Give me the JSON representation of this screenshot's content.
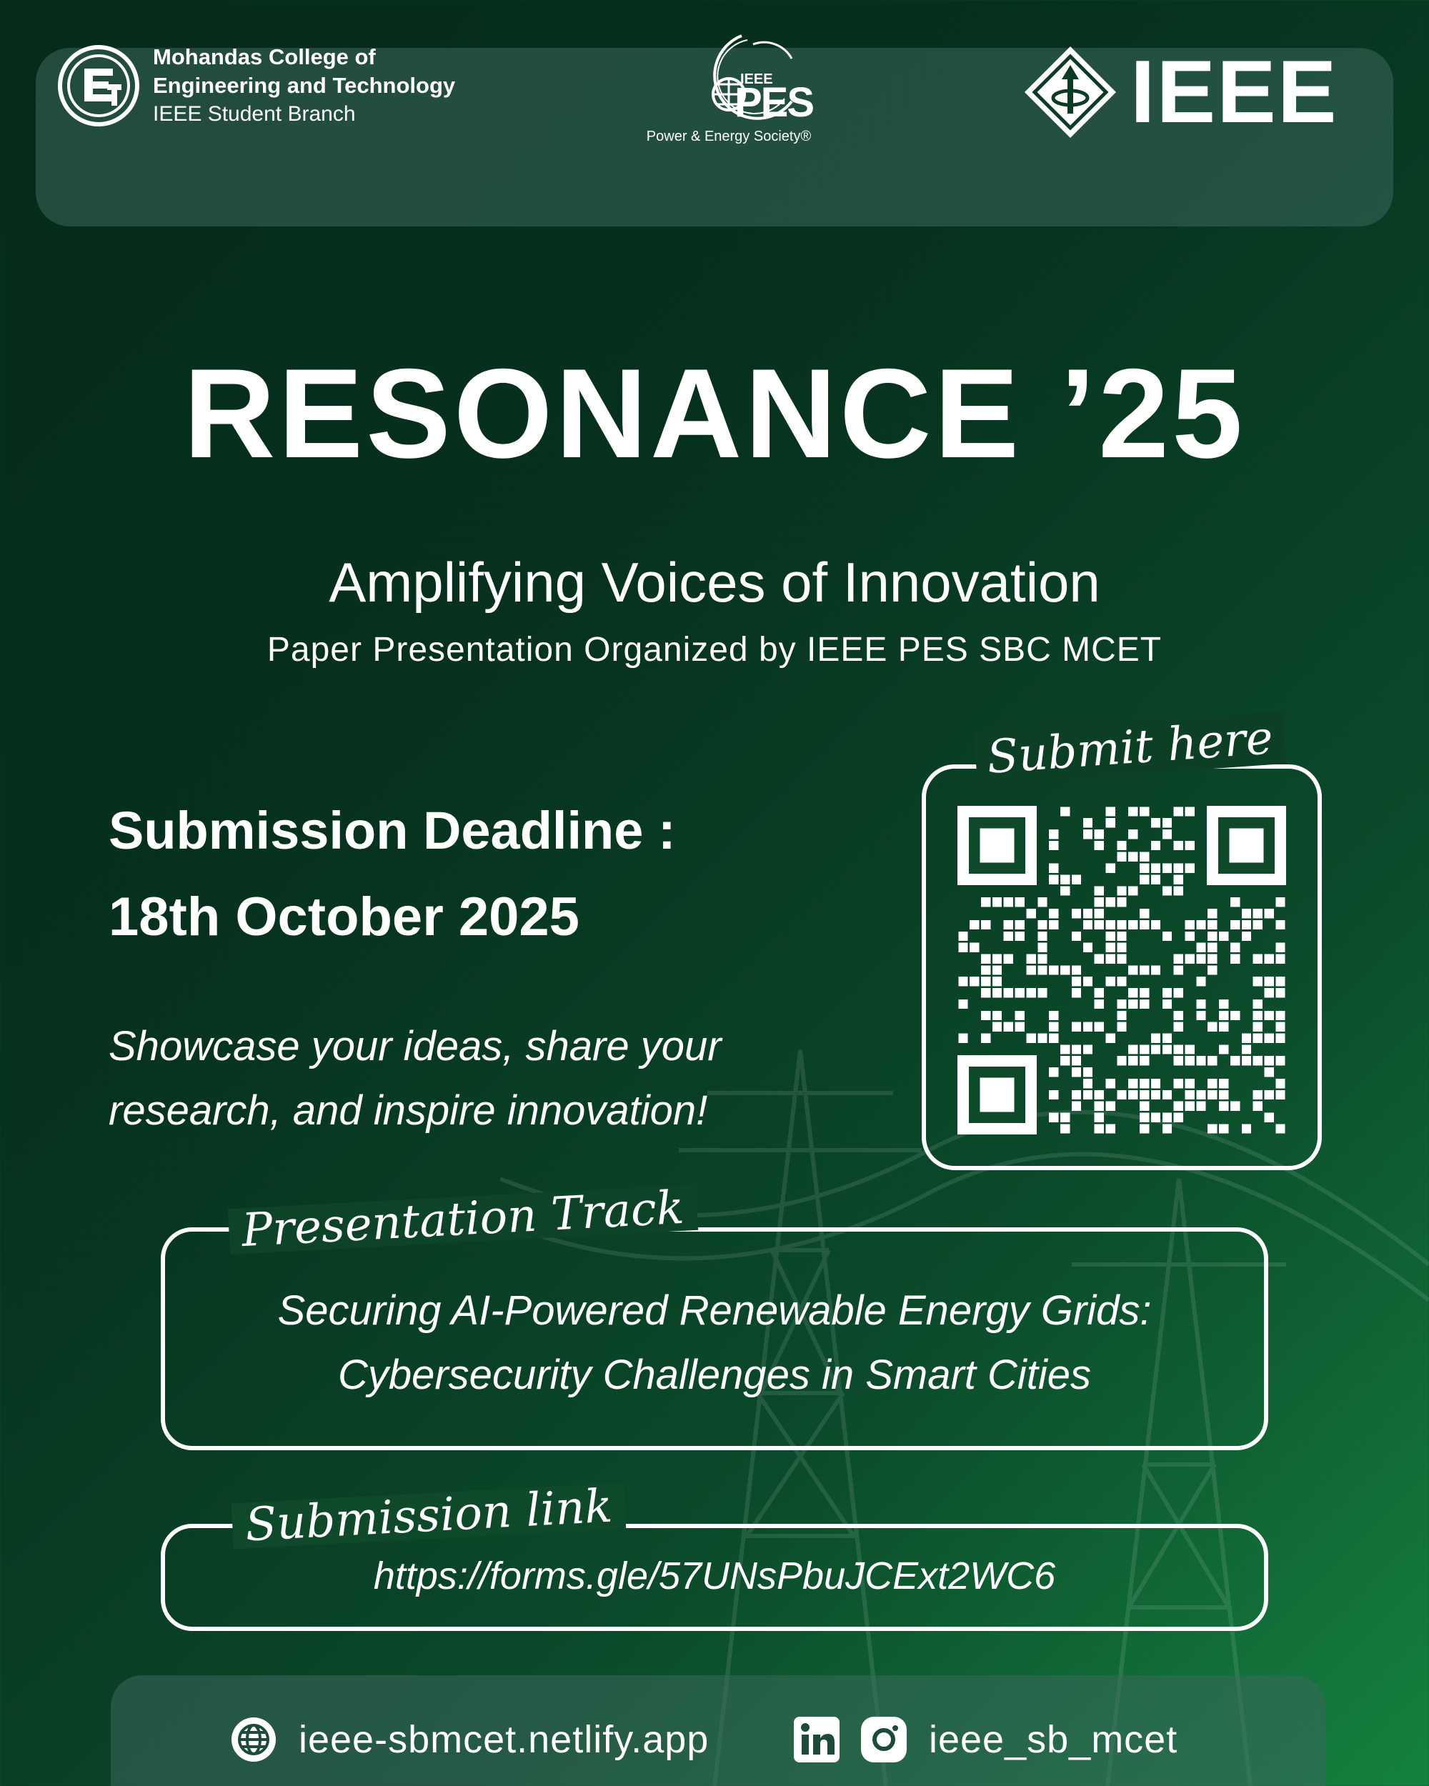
{
  "header": {
    "college_line1": "Mohandas College of",
    "college_line2": "Engineering and Technology",
    "college_line3": "IEEE Student Branch",
    "pes_ieee": "IEEE",
    "pes_word": "PES",
    "pes_society": "Power & Energy Society®",
    "ieee_word": "IEEE"
  },
  "event": {
    "title": "RESONANCE ’25",
    "tagline": "Amplifying Voices of Innovation",
    "subtitle": "Paper Presentation Organized by IEEE PES SBC MCET"
  },
  "deadline": {
    "label": "Submission Deadline :",
    "date": "18th October 2025"
  },
  "promo": "Showcase your ideas, share your research, and inspire innovation!",
  "qr": {
    "caption": "Submit here"
  },
  "track": {
    "caption": "Presentation Track",
    "line1": "Securing AI-Powered Renewable Energy Grids:",
    "line2": "Cybersecurity Challenges in Smart Cities"
  },
  "submission": {
    "caption": "Submission link",
    "url": "https://forms.gle/57UNsPbuJCExt2WC6"
  },
  "footer": {
    "website": "ieee-sbmcet.netlify.app",
    "social_handle": "ieee_sb_mcet",
    "icons": [
      "globe-icon",
      "linkedin-icon",
      "instagram-icon"
    ]
  },
  "colors": {
    "background_dark": "#062a1a",
    "background_bright": "#15813f",
    "panel": "#3a685c",
    "text": "#ffffff"
  }
}
